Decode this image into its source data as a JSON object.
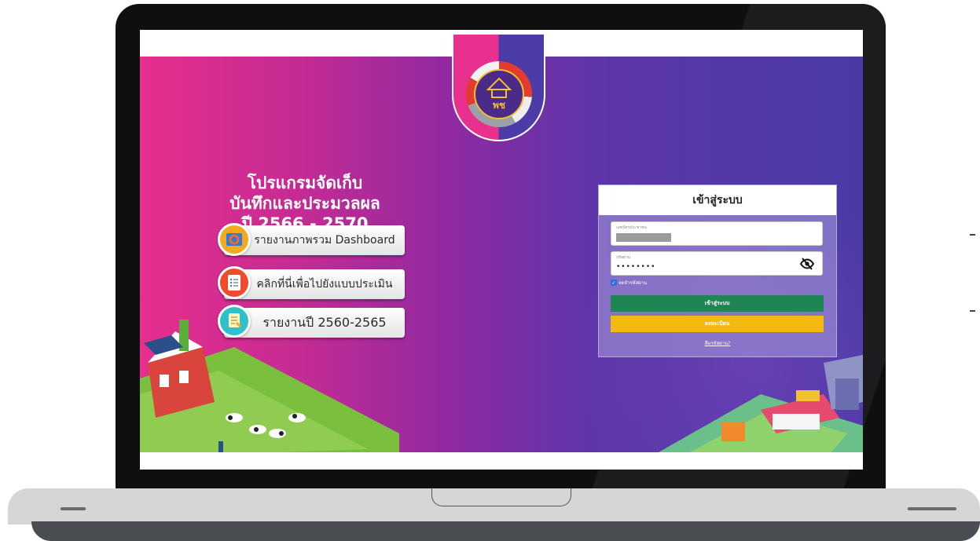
{
  "header": {
    "logo_text": "พช"
  },
  "title": {
    "line1": "โปรแกรมจัดเก็บ",
    "line2": "บันทึกและประมวลผล",
    "line3": "ปี 2566 - 2570"
  },
  "menu": [
    {
      "label": "รายงานภาพรวม Dashboard",
      "icon": "dashboard-chart-icon"
    },
    {
      "label": "คลิกที่นี่เพื่อไปยังแบบประเมิน",
      "icon": "checklist-icon"
    },
    {
      "label": "รายงานปี 2560-2565",
      "icon": "report-document-icon"
    }
  ],
  "login": {
    "title": "เข้าสู่ระบบ",
    "username_label": "เลขบัตรประชาชน",
    "password_label": "รหัสผ่าน",
    "password_value": "••••••••",
    "remember_label": "จดจำรหัสผ่าน",
    "login_button": "เข้าสู่ระบบ",
    "register_button": "ลงทะเบียน",
    "forgot_link": "ลืมรหัสผ่าน?"
  },
  "colors": {
    "gradient_pink": "#e62f8e",
    "gradient_purple": "#4a3aa6",
    "login_green": "#1f8553",
    "register_yellow": "#f4b90e"
  }
}
